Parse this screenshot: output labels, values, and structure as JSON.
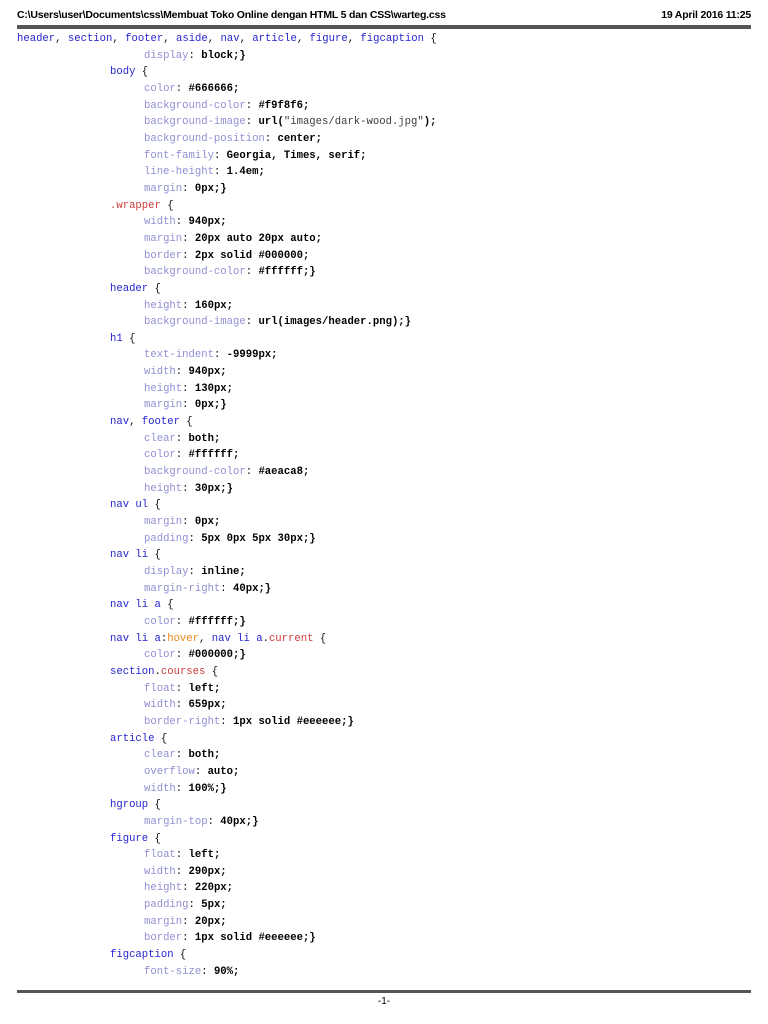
{
  "header": {
    "filepath": "C:\\Users\\user\\Documents\\css\\Membuat Toko Online dengan HTML 5 dan CSS\\warteg.css",
    "datetime": "19 April 2016 11:25"
  },
  "footer": {
    "page_number": "-1-"
  },
  "syntax_colors": {
    "selector": "#2525cc",
    "property": "#8f8fd4",
    "value": "#000000",
    "class_selector": "#cc3b3b",
    "pseudo_class": "#ef8616",
    "string": "#3d3d3d",
    "plain": "#111111"
  },
  "code": {
    "lines": [
      {
        "indent": 0,
        "tokens": [
          [
            "sel",
            "header"
          ],
          [
            "pln",
            ", "
          ],
          [
            "sel",
            "section"
          ],
          [
            "pln",
            ", "
          ],
          [
            "sel",
            "footer"
          ],
          [
            "pln",
            ", "
          ],
          [
            "sel",
            "aside"
          ],
          [
            "pln",
            ", "
          ],
          [
            "sel",
            "nav"
          ],
          [
            "pln",
            ", "
          ],
          [
            "sel",
            "article"
          ],
          [
            "pln",
            ", "
          ],
          [
            "sel",
            "figure"
          ],
          [
            "pln",
            ", "
          ],
          [
            "sel",
            "figcaption"
          ],
          [
            "pln",
            " {"
          ]
        ]
      },
      {
        "indent": 2,
        "tokens": [
          [
            "prop",
            "display"
          ],
          [
            "pln",
            ": "
          ],
          [
            "val",
            "block;}"
          ]
        ]
      },
      {
        "indent": 1,
        "tokens": [
          [
            "sel",
            "body"
          ],
          [
            "pln",
            " {"
          ]
        ]
      },
      {
        "indent": 2,
        "tokens": [
          [
            "prop",
            "color"
          ],
          [
            "pln",
            ": "
          ],
          [
            "val",
            "#666666;"
          ]
        ]
      },
      {
        "indent": 2,
        "tokens": [
          [
            "prop",
            "background-color"
          ],
          [
            "pln",
            ": "
          ],
          [
            "val",
            "#f9f8f6;"
          ]
        ]
      },
      {
        "indent": 2,
        "tokens": [
          [
            "prop",
            "background-image"
          ],
          [
            "pln",
            ": "
          ],
          [
            "val",
            "url("
          ],
          [
            "str",
            "\"images/dark-wood.jpg\""
          ],
          [
            "val",
            ");"
          ]
        ]
      },
      {
        "indent": 2,
        "tokens": [
          [
            "prop",
            "background-position"
          ],
          [
            "pln",
            ": "
          ],
          [
            "val",
            "center;"
          ]
        ]
      },
      {
        "indent": 2,
        "tokens": [
          [
            "prop",
            "font-family"
          ],
          [
            "pln",
            ": "
          ],
          [
            "val",
            "Georgia, Times, serif;"
          ]
        ]
      },
      {
        "indent": 2,
        "tokens": [
          [
            "prop",
            "line-height"
          ],
          [
            "pln",
            ": "
          ],
          [
            "val",
            "1.4em;"
          ]
        ]
      },
      {
        "indent": 2,
        "tokens": [
          [
            "prop",
            "margin"
          ],
          [
            "pln",
            ": "
          ],
          [
            "val",
            "0px;}"
          ]
        ]
      },
      {
        "indent": 1,
        "tokens": [
          [
            "cls",
            ".wrapper"
          ],
          [
            "pln",
            " {"
          ]
        ]
      },
      {
        "indent": 2,
        "tokens": [
          [
            "prop",
            "width"
          ],
          [
            "pln",
            ": "
          ],
          [
            "val",
            "940px;"
          ]
        ]
      },
      {
        "indent": 2,
        "tokens": [
          [
            "prop",
            "margin"
          ],
          [
            "pln",
            ": "
          ],
          [
            "val",
            "20px auto 20px auto;"
          ]
        ]
      },
      {
        "indent": 2,
        "tokens": [
          [
            "prop",
            "border"
          ],
          [
            "pln",
            ": "
          ],
          [
            "val",
            "2px solid #000000;"
          ]
        ]
      },
      {
        "indent": 2,
        "tokens": [
          [
            "prop",
            "background-color"
          ],
          [
            "pln",
            ": "
          ],
          [
            "val",
            "#ffffff;}"
          ]
        ]
      },
      {
        "indent": 1,
        "tokens": [
          [
            "sel",
            "header"
          ],
          [
            "pln",
            " {"
          ]
        ]
      },
      {
        "indent": 2,
        "tokens": [
          [
            "prop",
            "height"
          ],
          [
            "pln",
            ": "
          ],
          [
            "val",
            "160px;"
          ]
        ]
      },
      {
        "indent": 2,
        "tokens": [
          [
            "prop",
            "background-image"
          ],
          [
            "pln",
            ": "
          ],
          [
            "val",
            "url(images/header.png);}"
          ]
        ]
      },
      {
        "indent": 1,
        "tokens": [
          [
            "sel",
            "h1"
          ],
          [
            "pln",
            " {"
          ]
        ]
      },
      {
        "indent": 2,
        "tokens": [
          [
            "prop",
            "text-indent"
          ],
          [
            "pln",
            ": "
          ],
          [
            "val",
            "-9999px;"
          ]
        ]
      },
      {
        "indent": 2,
        "tokens": [
          [
            "prop",
            "width"
          ],
          [
            "pln",
            ": "
          ],
          [
            "val",
            "940px;"
          ]
        ]
      },
      {
        "indent": 2,
        "tokens": [
          [
            "prop",
            "height"
          ],
          [
            "pln",
            ": "
          ],
          [
            "val",
            "130px;"
          ]
        ]
      },
      {
        "indent": 2,
        "tokens": [
          [
            "prop",
            "margin"
          ],
          [
            "pln",
            ": "
          ],
          [
            "val",
            "0px;}"
          ]
        ]
      },
      {
        "indent": 1,
        "tokens": [
          [
            "sel",
            "nav"
          ],
          [
            "pln",
            ", "
          ],
          [
            "sel",
            "footer"
          ],
          [
            "pln",
            " {"
          ]
        ]
      },
      {
        "indent": 2,
        "tokens": [
          [
            "prop",
            "clear"
          ],
          [
            "pln",
            ": "
          ],
          [
            "val",
            "both;"
          ]
        ]
      },
      {
        "indent": 2,
        "tokens": [
          [
            "prop",
            "color"
          ],
          [
            "pln",
            ": "
          ],
          [
            "val",
            "#ffffff;"
          ]
        ]
      },
      {
        "indent": 2,
        "tokens": [
          [
            "prop",
            "background-color"
          ],
          [
            "pln",
            ": "
          ],
          [
            "val",
            "#aeaca8;"
          ]
        ]
      },
      {
        "indent": 2,
        "tokens": [
          [
            "prop",
            "height"
          ],
          [
            "pln",
            ": "
          ],
          [
            "val",
            "30px;}"
          ]
        ]
      },
      {
        "indent": 1,
        "tokens": [
          [
            "sel",
            "nav ul"
          ],
          [
            "pln",
            " {"
          ]
        ]
      },
      {
        "indent": 2,
        "tokens": [
          [
            "prop",
            "margin"
          ],
          [
            "pln",
            ": "
          ],
          [
            "val",
            "0px;"
          ]
        ]
      },
      {
        "indent": 2,
        "tokens": [
          [
            "prop",
            "padding"
          ],
          [
            "pln",
            ": "
          ],
          [
            "val",
            "5px 0px 5px 30px;}"
          ]
        ]
      },
      {
        "indent": 1,
        "tokens": [
          [
            "sel",
            "nav li"
          ],
          [
            "pln",
            " {"
          ]
        ]
      },
      {
        "indent": 2,
        "tokens": [
          [
            "prop",
            "display"
          ],
          [
            "pln",
            ": "
          ],
          [
            "val",
            "inline;"
          ]
        ]
      },
      {
        "indent": 2,
        "tokens": [
          [
            "prop",
            "margin-right"
          ],
          [
            "pln",
            ": "
          ],
          [
            "val",
            "40px;}"
          ]
        ]
      },
      {
        "indent": 1,
        "tokens": [
          [
            "sel",
            "nav li a"
          ],
          [
            "pln",
            " {"
          ]
        ]
      },
      {
        "indent": 2,
        "tokens": [
          [
            "prop",
            "color"
          ],
          [
            "pln",
            ": "
          ],
          [
            "val",
            "#ffffff;}"
          ]
        ]
      },
      {
        "indent": 1,
        "tokens": [
          [
            "sel",
            "nav li a"
          ],
          [
            "pln",
            ":"
          ],
          [
            "psd",
            "hover"
          ],
          [
            "pln",
            ", "
          ],
          [
            "sel",
            "nav li a"
          ],
          [
            "pln",
            "."
          ],
          [
            "cls",
            "current"
          ],
          [
            "pln",
            " {"
          ]
        ]
      },
      {
        "indent": 2,
        "tokens": [
          [
            "prop",
            "color"
          ],
          [
            "pln",
            ": "
          ],
          [
            "val",
            "#000000;}"
          ]
        ]
      },
      {
        "indent": 1,
        "tokens": [
          [
            "sel",
            "section"
          ],
          [
            "pln",
            "."
          ],
          [
            "cls",
            "courses"
          ],
          [
            "pln",
            " {"
          ]
        ]
      },
      {
        "indent": 2,
        "tokens": [
          [
            "prop",
            "float"
          ],
          [
            "pln",
            ": "
          ],
          [
            "val",
            "left;"
          ]
        ]
      },
      {
        "indent": 2,
        "tokens": [
          [
            "prop",
            "width"
          ],
          [
            "pln",
            ": "
          ],
          [
            "val",
            "659px;"
          ]
        ]
      },
      {
        "indent": 2,
        "tokens": [
          [
            "prop",
            "border-right"
          ],
          [
            "pln",
            ": "
          ],
          [
            "val",
            "1px solid #eeeeee;}"
          ]
        ]
      },
      {
        "indent": 1,
        "tokens": [
          [
            "sel",
            "article"
          ],
          [
            "pln",
            " {"
          ]
        ]
      },
      {
        "indent": 2,
        "tokens": [
          [
            "prop",
            "clear"
          ],
          [
            "pln",
            ": "
          ],
          [
            "val",
            "both;"
          ]
        ]
      },
      {
        "indent": 2,
        "tokens": [
          [
            "prop",
            "overflow"
          ],
          [
            "pln",
            ": "
          ],
          [
            "val",
            "auto;"
          ]
        ]
      },
      {
        "indent": 2,
        "tokens": [
          [
            "prop",
            "width"
          ],
          [
            "pln",
            ": "
          ],
          [
            "val",
            "100%;}"
          ]
        ]
      },
      {
        "indent": 1,
        "tokens": [
          [
            "sel",
            "hgroup"
          ],
          [
            "pln",
            " {"
          ]
        ]
      },
      {
        "indent": 2,
        "tokens": [
          [
            "prop",
            "margin-top"
          ],
          [
            "pln",
            ": "
          ],
          [
            "val",
            "40px;}"
          ]
        ]
      },
      {
        "indent": 1,
        "tokens": [
          [
            "sel",
            "figure"
          ],
          [
            "pln",
            " {"
          ]
        ]
      },
      {
        "indent": 2,
        "tokens": [
          [
            "prop",
            "float"
          ],
          [
            "pln",
            ": "
          ],
          [
            "val",
            "left;"
          ]
        ]
      },
      {
        "indent": 2,
        "tokens": [
          [
            "prop",
            "width"
          ],
          [
            "pln",
            ": "
          ],
          [
            "val",
            "290px;"
          ]
        ]
      },
      {
        "indent": 2,
        "tokens": [
          [
            "prop",
            "height"
          ],
          [
            "pln",
            ": "
          ],
          [
            "val",
            "220px;"
          ]
        ]
      },
      {
        "indent": 2,
        "tokens": [
          [
            "prop",
            "padding"
          ],
          [
            "pln",
            ": "
          ],
          [
            "val",
            "5px;"
          ]
        ]
      },
      {
        "indent": 2,
        "tokens": [
          [
            "prop",
            "margin"
          ],
          [
            "pln",
            ": "
          ],
          [
            "val",
            "20px;"
          ]
        ]
      },
      {
        "indent": 2,
        "tokens": [
          [
            "prop",
            "border"
          ],
          [
            "pln",
            ": "
          ],
          [
            "val",
            "1px solid #eeeeee;}"
          ]
        ]
      },
      {
        "indent": 1,
        "tokens": [
          [
            "sel",
            "figcaption"
          ],
          [
            "pln",
            " {"
          ]
        ]
      },
      {
        "indent": 2,
        "tokens": [
          [
            "prop",
            "font-size"
          ],
          [
            "pln",
            ": "
          ],
          [
            "val",
            "90%;"
          ]
        ]
      }
    ]
  }
}
